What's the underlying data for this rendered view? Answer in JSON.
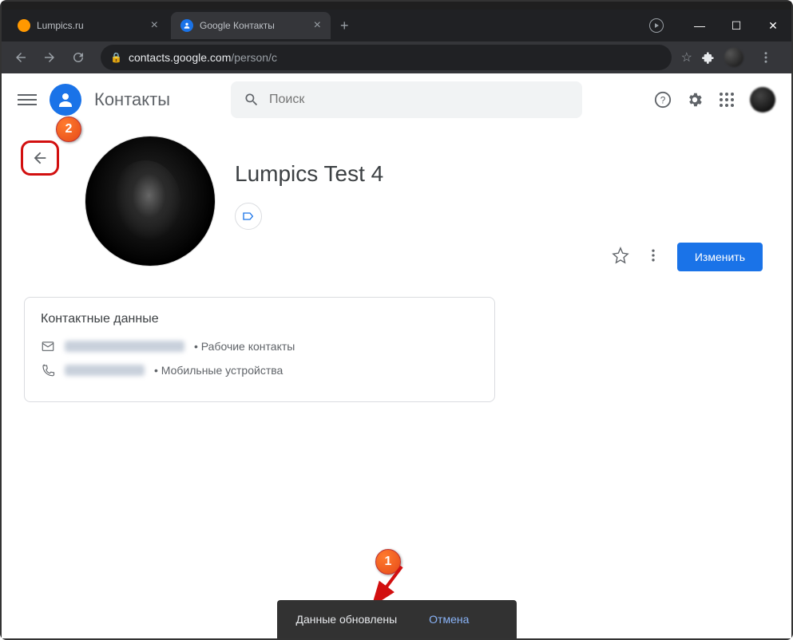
{
  "browser": {
    "tabs": [
      {
        "title": "Lumpics.ru"
      },
      {
        "title": "Google Контакты"
      }
    ],
    "url_host": "contacts.google.com",
    "url_path": "/person/c"
  },
  "app": {
    "title": "Контакты",
    "search_placeholder": "Поиск"
  },
  "contact": {
    "name": "Lumpics Test 4",
    "edit_button": "Изменить",
    "details_title": "Контактные данные",
    "rows": [
      {
        "type": "email",
        "label_suffix": "• Рабочие контакты"
      },
      {
        "type": "phone",
        "label_suffix": "• Мобильные устройства"
      }
    ]
  },
  "toast": {
    "message": "Данные обновлены",
    "action": "Отмена"
  },
  "annotations": {
    "marker1": "1",
    "marker2": "2"
  }
}
